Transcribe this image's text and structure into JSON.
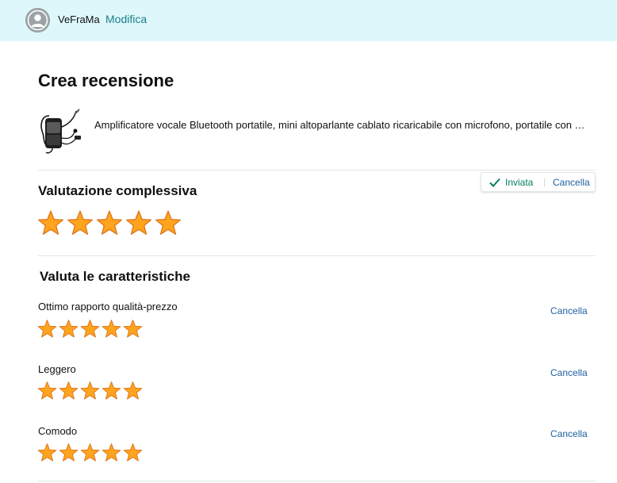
{
  "header": {
    "username": "VeFraMa",
    "edit_label": "Modifica"
  },
  "page": {
    "title": "Crea recensione"
  },
  "product": {
    "title": "Amplificatore vocale Bluetooth portatile, mini altoparlante cablato ricaricabile con microfono, portatile con clip da cintura"
  },
  "overall": {
    "title": "Valutazione complessiva",
    "rating": 5,
    "max": 5,
    "status_label": "Inviata",
    "cancel_label": "Cancella"
  },
  "features": {
    "title": "Valuta le caratteristiche",
    "items": [
      {
        "label": "Ottimo rapporto qualità-prezzo",
        "rating": 5,
        "max": 5,
        "cancel_label": "Cancella"
      },
      {
        "label": "Leggero",
        "rating": 5,
        "max": 5,
        "cancel_label": "Cancella"
      },
      {
        "label": "Comodo",
        "rating": 5,
        "max": 5,
        "cancel_label": "Cancella"
      }
    ]
  },
  "colors": {
    "header_bg": "#def7fb",
    "link": "#2162a1",
    "edit_link": "#1a7f8b",
    "success": "#067d62",
    "star_fill": "#ffa41c",
    "star_stroke": "#de7921"
  }
}
